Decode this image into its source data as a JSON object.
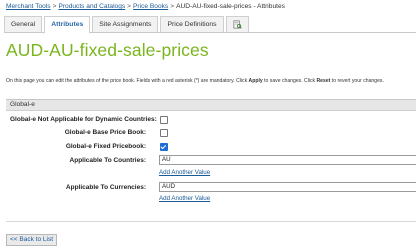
{
  "breadcrumb": {
    "items": [
      "Merchant Tools",
      "Products and Catalogs",
      "Price Books"
    ],
    "separator": ">",
    "current": "AUD-AU-fixed-sale-prices - Attributes"
  },
  "tabs": [
    {
      "label": "General",
      "active": false
    },
    {
      "label": "Attributes",
      "active": true
    },
    {
      "label": "Site Assignments",
      "active": false
    },
    {
      "label": "Price Definitions",
      "active": false
    }
  ],
  "icons": {
    "extra_tab": "edit-document-icon"
  },
  "page_title": "AUD-AU-fixed-sale-prices",
  "info_text": {
    "before_apply": "On this page you can edit the attributes of the price book. Fields with a red asterisk (*) are mandatory. Click ",
    "apply": "Apply",
    "middle": " to save changes. Click ",
    "reset": "Reset",
    "after": " to revert your changes."
  },
  "section": {
    "title": "Global-e",
    "fields": {
      "not_applicable_label": "Global-e Not Applicable for Dynamic Countries:",
      "not_applicable_checked": false,
      "base_price_label": "Global-e Base Price Book:",
      "base_price_checked": false,
      "fixed_price_label": "Global-e Fixed Pricebook:",
      "fixed_price_checked": true,
      "countries_label": "Applicable To Countries:",
      "countries_value": "AU",
      "currencies_label": "Applicable To Currencies:",
      "currencies_value": "AUD",
      "add_value_label": "Add Another Value"
    }
  },
  "back_button": "<< Back to List",
  "colors": {
    "title_green": "#7ab51d",
    "link_blue": "#1a5a96",
    "checkbox_blue": "#1f6bd8"
  }
}
